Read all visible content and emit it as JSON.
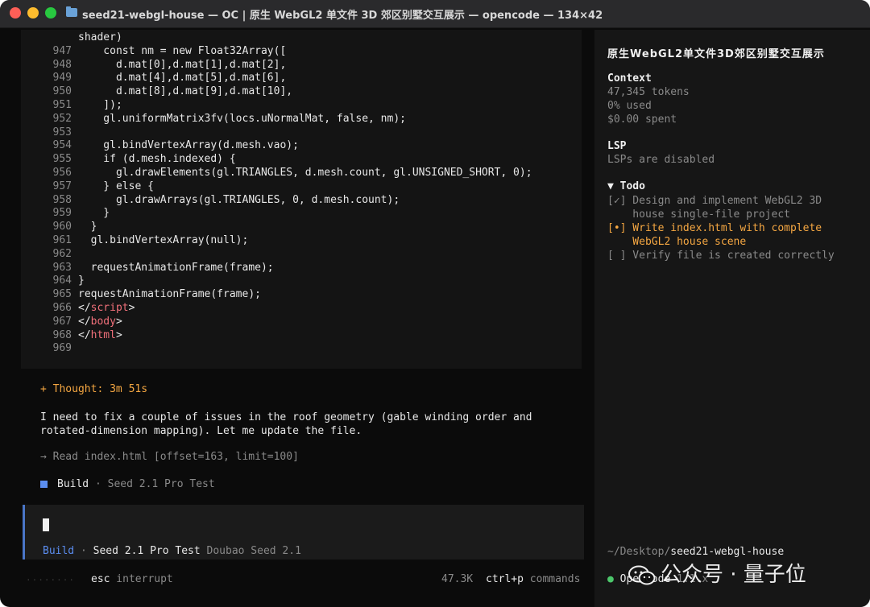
{
  "window": {
    "title": "seed21-webgl-house — OC | 原生 WebGL2 单文件 3D 郊区别墅交互展示 — opencode — 134×42"
  },
  "code": {
    "lines": [
      {
        "num": "",
        "text": "shader)"
      },
      {
        "num": "947",
        "text": "    const nm = new Float32Array(["
      },
      {
        "num": "948",
        "text": "      d.mat[0],d.mat[1],d.mat[2],"
      },
      {
        "num": "949",
        "text": "      d.mat[4],d.mat[5],d.mat[6],"
      },
      {
        "num": "950",
        "text": "      d.mat[8],d.mat[9],d.mat[10],"
      },
      {
        "num": "951",
        "text": "    ]);"
      },
      {
        "num": "952",
        "text": "    gl.uniformMatrix3fv(locs.uNormalMat, false, nm);"
      },
      {
        "num": "953",
        "text": ""
      },
      {
        "num": "954",
        "text": "    gl.bindVertexArray(d.mesh.vao);"
      },
      {
        "num": "955",
        "text": "    if (d.mesh.indexed) {"
      },
      {
        "num": "956",
        "text": "      gl.drawElements(gl.TRIANGLES, d.mesh.count, gl.UNSIGNED_SHORT, 0);"
      },
      {
        "num": "957",
        "text": "    } else {"
      },
      {
        "num": "958",
        "text": "      gl.drawArrays(gl.TRIANGLES, 0, d.mesh.count);"
      },
      {
        "num": "959",
        "text": "    }"
      },
      {
        "num": "960",
        "text": "  }"
      },
      {
        "num": "961",
        "text": "  gl.bindVertexArray(null);"
      },
      {
        "num": "962",
        "text": ""
      },
      {
        "num": "963",
        "text": "  requestAnimationFrame(frame);"
      },
      {
        "num": "964",
        "text": "}"
      },
      {
        "num": "965",
        "text": "requestAnimationFrame(frame);"
      },
      {
        "num": "966",
        "text_pre": "</",
        "tag": "script",
        "text_post": ">"
      },
      {
        "num": "967",
        "text_pre": "</",
        "tag": "body",
        "text_post": ">"
      },
      {
        "num": "968",
        "text_pre": "</",
        "tag": "html",
        "text_post": ">"
      },
      {
        "num": "969",
        "text": ""
      }
    ]
  },
  "chat": {
    "thought": "+ Thought: 3m 51s",
    "para_line1": "I need to fix a couple of issues in the roof geometry (gable winding order and",
    "para_line2": "rotated-dimension mapping). Let me update the file.",
    "read_action": "→ Read index.html [offset=163, limit=100]",
    "build_label": "Build",
    "build_model": " · Seed 2.1 Pro Test"
  },
  "input": {
    "mode": "Build",
    "sep": " · ",
    "model": "Seed 2.1 Pro Test",
    "provider": " Doubao Seed 2.1"
  },
  "status": {
    "dots": "········",
    "esc_key": "esc",
    "esc_action": " interrupt",
    "tokens_short": "47.3K",
    "ctrlp_key": "ctrl+p",
    "ctrlp_action": " commands"
  },
  "sidebar": {
    "title": "原生WebGL2单文件3D郊区别墅交互展示",
    "context_head": "Context",
    "context_tokens": "47,345 tokens",
    "context_used": "0% used",
    "context_spent": "$0.00 spent",
    "lsp_head": "LSP",
    "lsp_status": "LSPs are disabled",
    "todo_head": "▼ Todo",
    "todo1_line1": "[✓] Design and implement WebGL2 3D",
    "todo1_line2": "    house single-file project",
    "todo2_line1": "[•] Write index.html with complete",
    "todo2_line2": "    WebGL2 house scene",
    "todo3": "[ ] Verify file is created correctly",
    "path_prefix": "~/Desktop/",
    "path_dir": "seed21-webgl-house",
    "oc_label": "OpenCode",
    "oc_version": " 1.1.x"
  },
  "watermark": {
    "text": "公众号 · 量子位"
  },
  "colors": {
    "accent_blue": "#5b8def",
    "orange": "#f5a742",
    "tag_red": "#f0707a"
  }
}
